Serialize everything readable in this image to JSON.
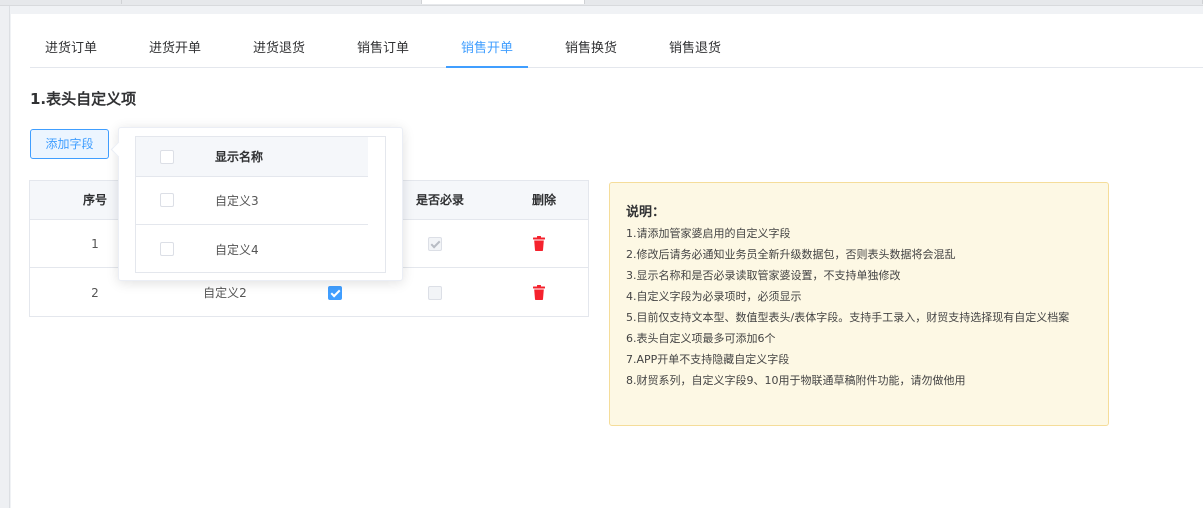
{
  "tabs": [
    {
      "label": "进货订单"
    },
    {
      "label": "进货开单"
    },
    {
      "label": "进货退货"
    },
    {
      "label": "销售订单"
    },
    {
      "label": "销售开单",
      "active": true
    },
    {
      "label": "销售换货"
    },
    {
      "label": "销售退货"
    }
  ],
  "section": {
    "title": "1.表头自定义项"
  },
  "add_button": {
    "label": "添加字段"
  },
  "table": {
    "headers": {
      "index": "序号",
      "required": "是否必录",
      "delete": "删除"
    },
    "rows": [
      {
        "index": "1",
        "name": "",
        "visible": false,
        "required": true,
        "required_disabled": true
      },
      {
        "index": "2",
        "name": "自定义2",
        "visible": true,
        "required": false,
        "required_disabled": true
      }
    ]
  },
  "popover": {
    "header": "显示名称",
    "items": [
      {
        "label": "自定义3",
        "checked": false
      },
      {
        "label": "自定义4",
        "checked": false
      }
    ]
  },
  "notes": {
    "title": "说明：",
    "items": [
      "1.请添加管家婆启用的自定义字段",
      "2.修改后请务必通知业务员全新升级数据包，否则表头数据将会混乱",
      "3.显示名称和是否必录读取管家婆设置，不支持单独修改",
      "4.自定义字段为必录项时，必须显示",
      "5.目前仅支持文本型、数值型表头/表体字段。支持手工录入，财贸支持选择现有自定义档案",
      "6.表头自定义项最多可添加6个",
      "7.APP开单不支持隐藏自定义字段",
      "8.财贸系列，自定义字段9、10用于物联通草稿附件功能，请勿做他用"
    ]
  },
  "colors": {
    "accent": "#409eff",
    "delete": "#f5222d",
    "notes_bg": "#fdf8e4",
    "notes_border": "#f5dd9a"
  }
}
